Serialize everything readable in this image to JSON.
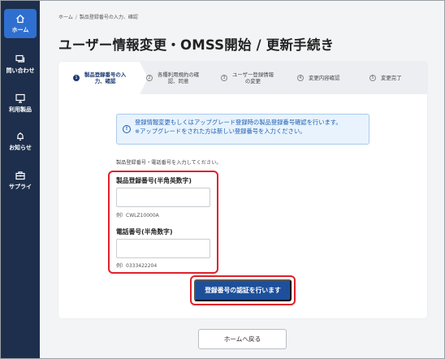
{
  "sidebar": {
    "items": [
      {
        "label": "ホーム",
        "icon": "home-icon"
      },
      {
        "label": "問い合わせ",
        "icon": "chat-icon"
      },
      {
        "label": "利用製品",
        "icon": "monitor-icon"
      },
      {
        "label": "お知らせ",
        "icon": "bell-icon"
      },
      {
        "label": "サプライ",
        "icon": "toolbox-icon"
      }
    ]
  },
  "breadcrumb": {
    "home": "ホーム",
    "separator": "/",
    "current": "製品登録番号の入力、確認"
  },
  "page_title": "ユーザー情報変更・OMSS開始 / 更新手続き",
  "steps": [
    {
      "num": "1",
      "line1": "製品登録番号の入",
      "line2": "力、確認"
    },
    {
      "num": "2",
      "line1": "各種利用規約の確",
      "line2": "認、同意"
    },
    {
      "num": "3",
      "line1": "ユーザー登録情報",
      "line2": "の変更"
    },
    {
      "num": "4",
      "line1": "変更内容確認",
      "line2": ""
    },
    {
      "num": "5",
      "line1": "変更完了",
      "line2": ""
    }
  ],
  "info": {
    "icon_glyph": "!",
    "line1": "登録情報変更もしくはアップグレード登録時の製品登録番号確認を行います。",
    "line2": "※アップグレードをされた方は新しい登録番号を入力ください。"
  },
  "instruction": "製品登録番号・電話番号を入力してください。",
  "form": {
    "product_label": "製品登録番号(半角英数字)",
    "product_value": "",
    "product_example": "例）CWLZ10000A",
    "phone_label": "電話番号(半角数字)",
    "phone_value": "",
    "phone_example": "例）0333422204"
  },
  "submit_label": "登録番号の認証を行います",
  "home_button_label": "ホームへ戻る",
  "colors": {
    "sidebar": "#1d2f4c",
    "active_nav": "#2f6fd0",
    "primary": "#1d4f9a",
    "highlight": "#e0202a",
    "info_bg": "#e8f3fd"
  }
}
